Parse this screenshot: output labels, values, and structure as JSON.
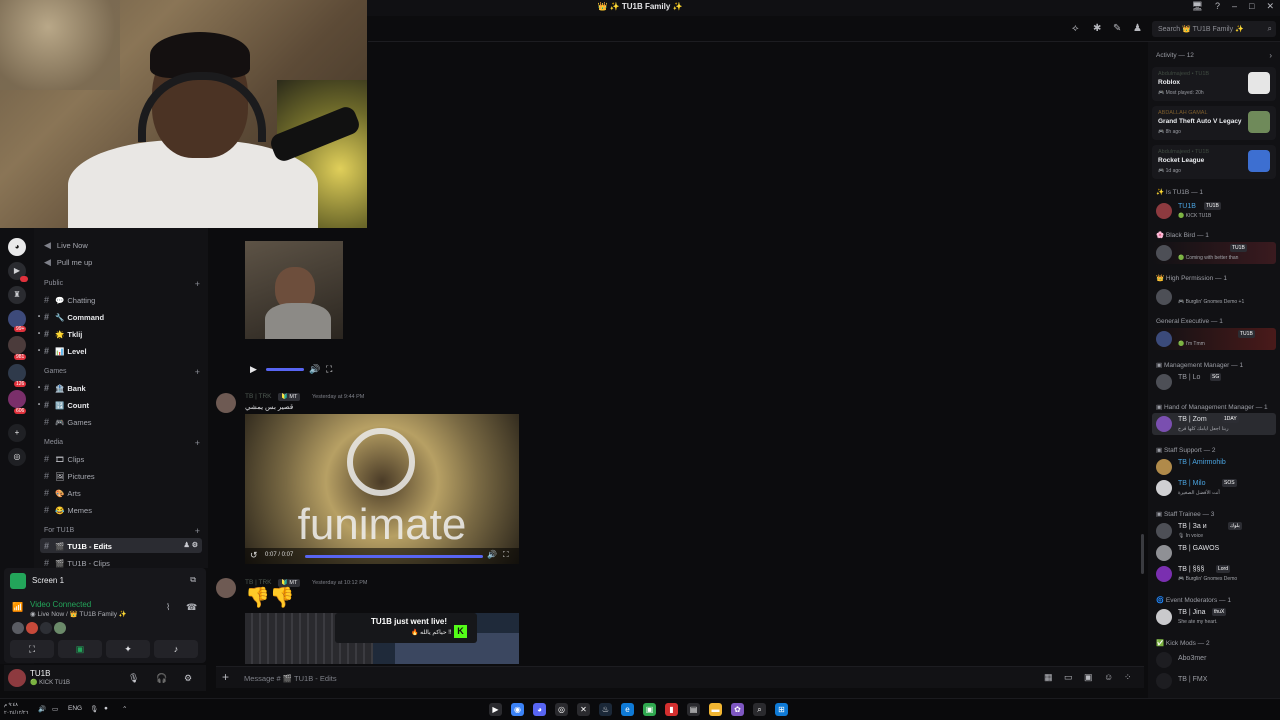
{
  "window": {
    "title": "👑 ✨ TU1B Family ✨",
    "controls": [
      "🖥",
      "?",
      "–",
      "□",
      "✕"
    ]
  },
  "header": {
    "search_placeholder": "Search 👑 TU1B Family ✨"
  },
  "rail": {
    "badges": [
      "1",
      "99+",
      "981",
      "126",
      "606"
    ]
  },
  "channels": {
    "items": [
      {
        "emoji": "◉",
        "name": "Live Now"
      },
      {
        "emoji": "◉",
        "name": "Pull me up"
      }
    ],
    "categories": [
      {
        "name": "Public",
        "channels": [
          {
            "emoji": "💬",
            "name": "Chatting"
          },
          {
            "emoji": "🔧",
            "name": "Command"
          },
          {
            "emoji": "🌟",
            "name": "Tklij"
          },
          {
            "emoji": "📊",
            "name": "Level"
          }
        ]
      },
      {
        "name": "Games",
        "channels": [
          {
            "emoji": "🏦",
            "name": "Bank"
          },
          {
            "emoji": "🔢",
            "name": "Count"
          },
          {
            "emoji": "🎮",
            "name": "Games"
          }
        ]
      },
      {
        "name": "Media",
        "channels": [
          {
            "emoji": "🎞",
            "name": "Clips"
          },
          {
            "emoji": "🖼",
            "name": "Pictures"
          },
          {
            "emoji": "🎨",
            "name": "Arts"
          },
          {
            "emoji": "😂",
            "name": "Memes"
          }
        ]
      },
      {
        "name": "For TU1B",
        "channels": [
          {
            "emoji": "🎬",
            "name": "TU1B - Edits"
          },
          {
            "emoji": "🎬",
            "name": "TU1B - Clips"
          }
        ]
      }
    ]
  },
  "voice": {
    "screen_label": "Screen 1",
    "status": "Video Connected",
    "channel": "◉ Live Now / 👑 TU1B Family ✨"
  },
  "user": {
    "name": "TU1B",
    "status": "🟢 KICK TU1B"
  },
  "chat": {
    "message1": {
      "author": "TB | TRK",
      "tag": "🔰 MT",
      "time": "Yesterday at 9:44 PM",
      "text": "قصير بس يمشي",
      "video_time": "0:07 / 0:07",
      "video_watermark": "funimate"
    },
    "message2": {
      "author": "TB | TRK",
      "tag": "🔰 MT",
      "time": "Yesterday at 10:12 PM",
      "emoji": "👎👎",
      "embed_title": "TU1B just went live!",
      "embed_sub": "🔥 حياكم يالله !!"
    },
    "composer_placeholder": "Message # 🎬 TU1B - Edits"
  },
  "members": {
    "activity_header": "Activity — 12",
    "activities": [
      {
        "user": "Abdulmajeed • TU1B",
        "game": "Roblox",
        "time": "🎮 Most played: 20h",
        "color": "#e6e6e6"
      },
      {
        "user": "ABDALLAH GAMAL",
        "game": "Grand Theft Auto V Legacy",
        "time": "🎮 8h ago",
        "color": "#6f8a5a"
      },
      {
        "user": "Abdulmajeed • TU1B",
        "game": "Rocket League",
        "time": "🎮 1d ago",
        "color": "#3d6fd1"
      }
    ],
    "groups": [
      {
        "role": "✨ Is TU1B — 1",
        "members": [
          {
            "name": "TU1B",
            "tag": "TU1B",
            "status": "🟢 KICK TU1B",
            "name_color": "#4aa3df"
          }
        ]
      },
      {
        "role": "🌸 Black Bird — 1",
        "members": [
          {
            "name": "",
            "tag": "TU1B",
            "status": "🟢 Coming with better than",
            "name_color": "#dfe0e4"
          }
        ]
      },
      {
        "role": "👑 High Permission — 1",
        "members": [
          {
            "name": "",
            "tag": "",
            "status": "🎮 Burglin' Gnomes Demo +1",
            "name_color": "#dfe0e4"
          }
        ]
      },
      {
        "role": "General Executive — 1",
        "members": [
          {
            "name": "",
            "tag": "TU1B",
            "status": "🟢 I'm Tmm",
            "name_color": "#dfe0e4"
          }
        ]
      },
      {
        "role": "▣ Management Manager — 1",
        "members": [
          {
            "name": "TB | Lo",
            "tag": "SG",
            "status": "",
            "name_color": "#9a9ca3"
          }
        ]
      },
      {
        "role": "▣ Hand of Management Manager — 1",
        "members": [
          {
            "name": "TB | Zom",
            "tag": "1DAY",
            "status": "ربنا اجعل ايامك كلها فرح",
            "name_color": "#dfe0e4"
          }
        ]
      },
      {
        "role": "▣ Staff Support — 2",
        "members": [
          {
            "name": "TB | Amirmohib",
            "tag": "",
            "status": "",
            "name_color": "#4aa3df"
          },
          {
            "name": "TB | Milo",
            "tag": "SOS",
            "status": "أنت الأفضل الصغيرة",
            "name_color": "#4aa3df"
          }
        ]
      },
      {
        "role": "▣ Staff Trainee — 3",
        "members": [
          {
            "name": "TB | За и",
            "tag": "بلوك",
            "status": "🎙 In voice",
            "name_color": "#dfe0e4"
          },
          {
            "name": "TB | GAWOS",
            "tag": "",
            "status": "",
            "name_color": "#dfe0e4"
          },
          {
            "name": "TB | §§§",
            "tag": "Lord",
            "status": "🎮 Burglin' Gnomes Demo",
            "name_color": "#dfe0e4"
          }
        ]
      },
      {
        "role": "🌀 Event Moderators — 1",
        "members": [
          {
            "name": "TB | Jina",
            "tag": "thuX",
            "status": "She ate my heart.",
            "name_color": "#dfe0e4"
          }
        ]
      },
      {
        "role": "✅ Kick Mods — 2",
        "members": [
          {
            "name": "Abo3mer",
            "tag": "",
            "status": "",
            "name_color": "#9a9ca3"
          },
          {
            "name": "TB | FMX",
            "tag": "",
            "status": "",
            "name_color": "#9a9ca3"
          }
        ]
      }
    ]
  },
  "taskbar": {
    "lang": "ENG",
    "date": "٢٠٢٤/١٢/٢٦",
    "time": "٩:٤٨ م"
  }
}
